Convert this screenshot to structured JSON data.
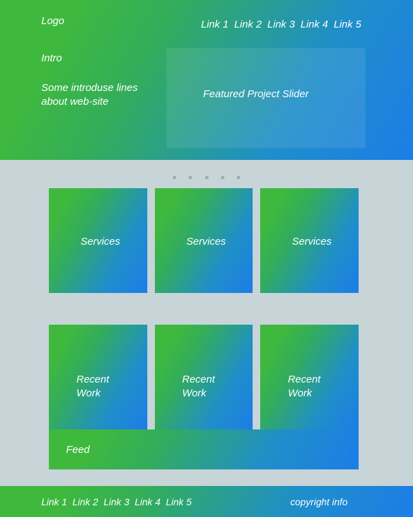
{
  "hero": {
    "logo": "Logo",
    "intro_title": "Intro",
    "intro_lines": "Some introduse lines about web-site",
    "featured": "Featured Project Slider"
  },
  "nav": {
    "items": [
      "Link 1",
      "Link 2",
      "Link 3",
      "Link 4",
      "Link 5"
    ]
  },
  "services": {
    "items": [
      "Services",
      "Services",
      "Services"
    ]
  },
  "recent": {
    "items": [
      "Recent Work",
      "Recent Work",
      "Recent Work"
    ]
  },
  "feed": {
    "label": "Feed"
  },
  "footer": {
    "nav": [
      "Link 1",
      "Link 2",
      "Link 3",
      "Link 4",
      "Link 5"
    ],
    "copyright": "copyright info"
  }
}
